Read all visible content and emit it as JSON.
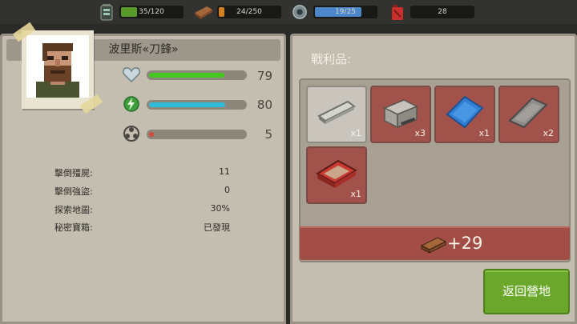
{
  "resources": [
    {
      "name": "battery",
      "icon": "battery-icon",
      "value": "35/120",
      "fill_fraction": 0.29,
      "fill_color": "#5a9a2a"
    },
    {
      "name": "wood",
      "icon": "wood-plank-icon",
      "value": "24/250",
      "fill_fraction": 0.1,
      "fill_color": "#d2801f"
    },
    {
      "name": "parts",
      "icon": "gear-icon",
      "value": "19/25",
      "fill_fraction": 0.76,
      "fill_color": "#4b87c9"
    },
    {
      "name": "fuel",
      "icon": "fuel-can-icon",
      "value": "28",
      "fill_fraction": 0,
      "fill_color": "#c8302e"
    }
  ],
  "character": {
    "name": "波里斯«刀鋒»",
    "stats": [
      {
        "icon": "heart-icon",
        "value": "79",
        "fill_fraction": 0.79,
        "fill_color": "#44c81f"
      },
      {
        "icon": "energy-icon",
        "value": "80",
        "fill_fraction": 0.8,
        "fill_color": "#30bcd8"
      },
      {
        "icon": "biohazard-icon",
        "value": "5",
        "fill_fraction": 0.05,
        "fill_color": "#d84a3a"
      }
    ],
    "details": [
      {
        "label": "擊倒殭屍:",
        "value": "11"
      },
      {
        "label": "擊倒強盜:",
        "value": "0"
      },
      {
        "label": "探索地圖:",
        "value": "30%"
      },
      {
        "label": "秘密寶箱:",
        "value": "已發現"
      }
    ]
  },
  "loot": {
    "title": "戰利品:",
    "items": [
      {
        "icon": "metal-pipe-icon",
        "count": "x1",
        "style": "grey"
      },
      {
        "icon": "toolbox-icon",
        "count": "x3",
        "style": "red"
      },
      {
        "icon": "blue-cloth-icon",
        "count": "x1",
        "style": "red"
      },
      {
        "icon": "grey-cloth-icon",
        "count": "x2",
        "style": "red"
      },
      {
        "icon": "red-case-icon",
        "count": "x1",
        "style": "red"
      }
    ],
    "reward": {
      "icon": "wood-plank-icon",
      "value": "+29"
    }
  },
  "return_button_label": "返回營地"
}
